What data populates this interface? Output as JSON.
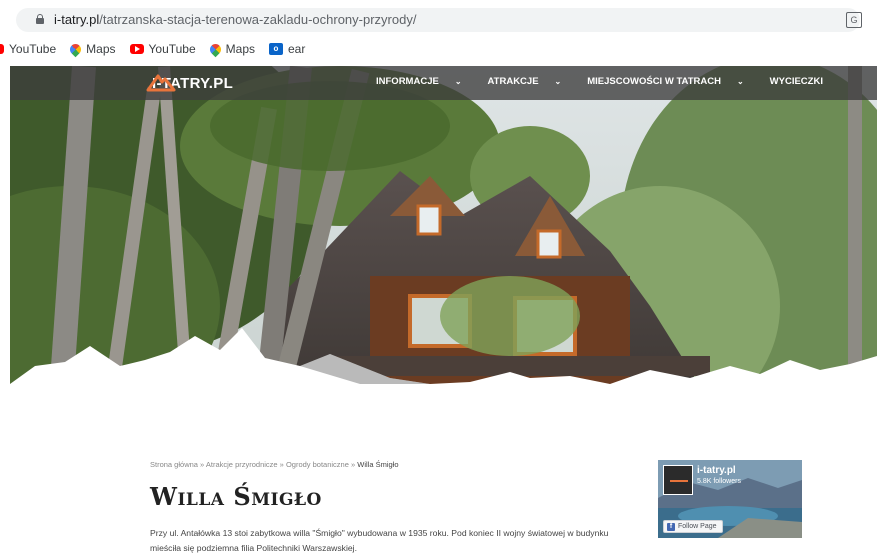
{
  "browser": {
    "url_host": "i-tatry.pl",
    "url_path": "/tatrzanska-stacja-terenowa-zakladu-ochrony-przyrody/",
    "translate_icon_label": "G",
    "bookmarks": [
      "YouTube",
      "Maps",
      "YouTube",
      "Maps",
      "ear"
    ]
  },
  "site": {
    "logo_text": "I-TATRY.PL",
    "nav": [
      {
        "label": "INFORMACJE",
        "dropdown": true
      },
      {
        "label": "ATRAKCJE",
        "dropdown": true
      },
      {
        "label": "MIEJSCOWOŚCI W TATRACH",
        "dropdown": true
      },
      {
        "label": "WYCIECZKI",
        "dropdown": false
      }
    ],
    "accent_color": "#e8743b"
  },
  "content": {
    "breadcrumb": [
      "Strona główna",
      "Atrakcje przyrodnicze",
      "Ogrody botaniczne",
      "Willa Śmigło"
    ],
    "breadcrumb_sep": " » ",
    "title": "Willa Śmigło",
    "paragraph": "Przy ul. Antałówka 13 stoi zabytkowa willa \"Śmigło\" wybudowana w 1935 roku. Pod koniec II wojny światowej w budynku mieściła się podziemna filia Politechniki Warszawskiej."
  },
  "facebook_widget": {
    "page_name": "i-tatry.pl",
    "followers": "5.8K followers",
    "button_label": "Follow Page",
    "button_icon_label": "f"
  }
}
